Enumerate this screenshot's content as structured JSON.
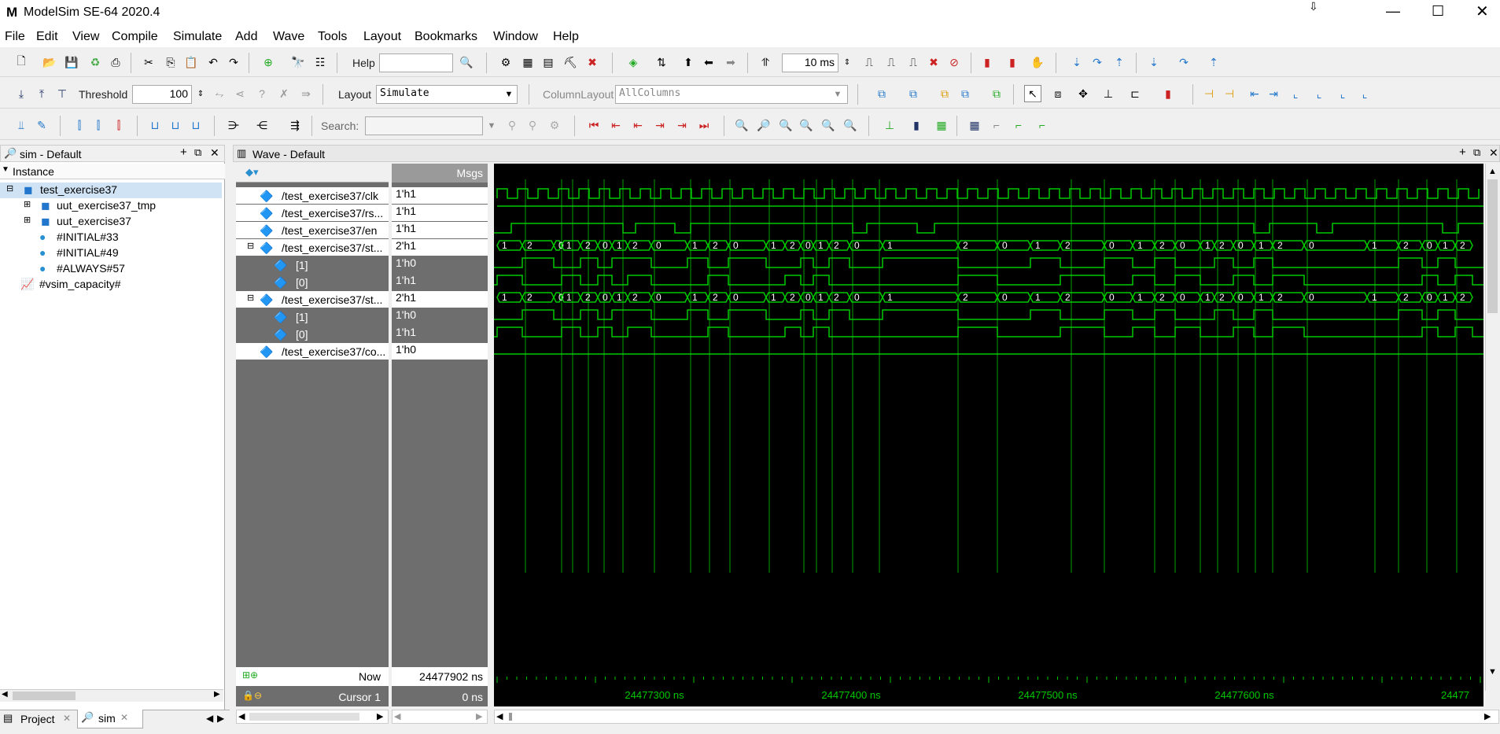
{
  "window": {
    "title": "ModelSim SE-64 2020.4",
    "logo": "M"
  },
  "menu": [
    "File",
    "Edit",
    "View",
    "Compile",
    "Simulate",
    "Add",
    "Wave",
    "Tools",
    "Layout",
    "Bookmarks",
    "Window",
    "Help"
  ],
  "toolbar": {
    "help_label": "Help",
    "help_value": "",
    "runlength": "10 ms",
    "threshold_label": "Threshold",
    "threshold_value": "100",
    "layout_label": "Layout",
    "layout_value": "Simulate",
    "columnlayout_label": "ColumnLayout",
    "columnlayout_value": "AllColumns",
    "search_label": "Search:",
    "search_value": ""
  },
  "sim_pane": {
    "title": "sim - Default",
    "column": "Instance",
    "items": [
      {
        "label": "test_exercise37",
        "icon": "module-icon"
      },
      {
        "label": "uut_exercise37_tmp",
        "icon": "module-icon"
      },
      {
        "label": "uut_exercise37",
        "icon": "module-icon"
      },
      {
        "label": "#INITIAL#33",
        "icon": "process-icon"
      },
      {
        "label": "#INITIAL#49",
        "icon": "process-icon"
      },
      {
        "label": "#ALWAYS#57",
        "icon": "process-icon"
      },
      {
        "label": "#vsim_capacity#",
        "icon": "capacity-icon"
      }
    ]
  },
  "wave_pane": {
    "title": "Wave - Default",
    "msgs": "Msgs",
    "signals": [
      {
        "name": "/test_exercise37/clk",
        "value": "1'h1"
      },
      {
        "name": "/test_exercise37/rs...",
        "value": "1'h1"
      },
      {
        "name": "/test_exercise37/en",
        "value": "1'h1"
      },
      {
        "name": "/test_exercise37/st...",
        "value": "2'h1"
      },
      {
        "name": "[1]",
        "value": "1'h0"
      },
      {
        "name": "[0]",
        "value": "1'h1"
      },
      {
        "name": "/test_exercise37/st...",
        "value": "2'h1"
      },
      {
        "name": "[1]",
        "value": "1'h0"
      },
      {
        "name": "[0]",
        "value": "1'h1"
      },
      {
        "name": "/test_exercise37/co...",
        "value": "1'h0"
      }
    ],
    "now_label": "Now",
    "now_value": "24477902 ns",
    "cursor_label": "Cursor 1",
    "cursor_value": "0 ns",
    "time_ticks": [
      "24477300 ns",
      "24477400 ns",
      "24477500 ns",
      "24477600 ns",
      "24477"
    ],
    "bus_values": [
      "1",
      "2",
      "0",
      "1",
      "2",
      "0",
      "1",
      "2",
      "0",
      "1",
      "2",
      "0",
      "1",
      "2",
      "0",
      "1",
      "2",
      "0",
      "1",
      "2",
      "0",
      "1",
      "2",
      "0",
      "1",
      "2",
      "0",
      "1",
      "2",
      "0",
      "1",
      "2",
      "0",
      "1",
      "2",
      "0",
      "1",
      "2",
      "0"
    ],
    "wave_color": "#00c800"
  },
  "tabs": [
    {
      "label": "Project"
    },
    {
      "label": "sim"
    }
  ]
}
